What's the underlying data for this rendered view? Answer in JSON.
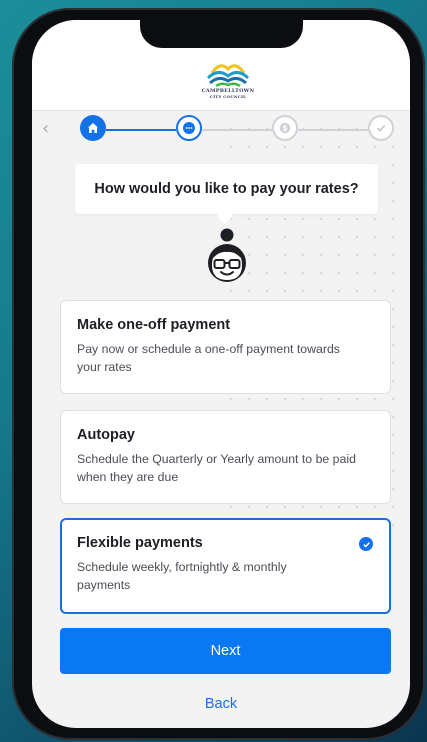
{
  "brand": {
    "logo_line1": "CAMPBELLTOWN",
    "logo_line2": "CITY COUNCIL"
  },
  "stepper": {
    "back_icon": "chevron-left-icon",
    "steps": [
      {
        "icon": "home-icon",
        "state": "complete"
      },
      {
        "icon": "chat-icon",
        "state": "current"
      },
      {
        "icon": "dollar-icon",
        "state": "upcoming"
      },
      {
        "icon": "check-icon",
        "state": "upcoming"
      }
    ]
  },
  "question": "How would you like to pay your rates?",
  "options": [
    {
      "title": "Make one-off payment",
      "description": "Pay now or schedule a one-off payment towards your rates",
      "selected": false
    },
    {
      "title": "Autopay",
      "description": "Schedule the Quarterly or Yearly amount to be paid when they are due",
      "selected": false
    },
    {
      "title": "Flexible payments",
      "description": "Schedule weekly, fortnightly & monthly payments",
      "selected": true
    }
  ],
  "actions": {
    "next_label": "Next",
    "back_label": "Back"
  },
  "colors": {
    "accent": "#1472e8",
    "button": "#0a78f2",
    "background": "#f3f3f4"
  }
}
